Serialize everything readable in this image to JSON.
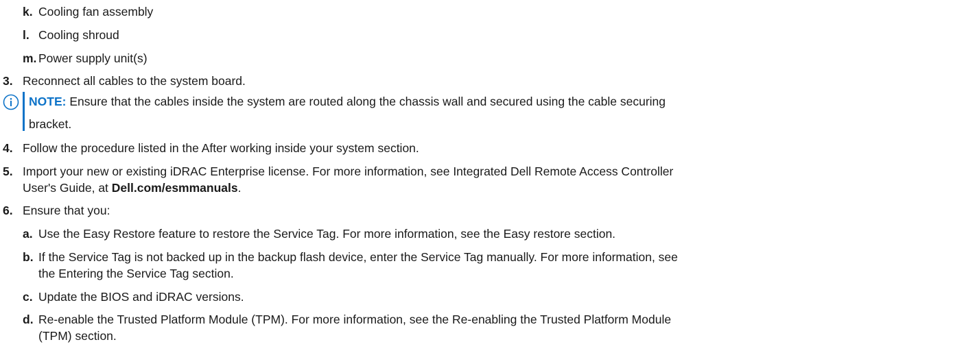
{
  "steps": {
    "k": {
      "marker": "k.",
      "text": "Cooling fan assembly"
    },
    "l": {
      "marker": "l.",
      "text": "Cooling shroud"
    },
    "m": {
      "marker": "m.",
      "text": "Power supply unit(s)"
    },
    "s3": {
      "marker": "3.",
      "text": "Reconnect all cables to the system board."
    },
    "note": {
      "label": "NOTE:",
      "text1": " Ensure that the cables inside the system are routed along the chassis wall and secured using the cable securing",
      "text2": "bracket."
    },
    "s4": {
      "marker": "4.",
      "text": "Follow the procedure listed in the After working inside your system section."
    },
    "s5": {
      "marker": "5.",
      "text1": "Import your new or existing iDRAC Enterprise license. For more information, see Integrated Dell Remote Access Controller",
      "text2a": "User's Guide, at ",
      "link": "Dell.com/esmmanuals",
      "text2b": "."
    },
    "s6": {
      "marker": "6.",
      "text": "Ensure that you:"
    },
    "a": {
      "marker": "a.",
      "text": "Use the Easy Restore feature to restore the Service Tag. For more information, see the Easy restore section."
    },
    "b": {
      "marker": "b.",
      "text1": "If the Service Tag is not backed up in the backup flash device, enter the Service Tag manually. For more information, see",
      "text2": "the Entering the Service Tag section."
    },
    "c": {
      "marker": "c.",
      "text": "Update the BIOS and iDRAC versions."
    },
    "d": {
      "marker": "d.",
      "text1": "Re-enable the Trusted Platform Module (TPM). For more information, see the Re-enabling the Trusted Platform Module",
      "text2": "(TPM) section."
    }
  },
  "colors": {
    "accent": "#0d73c8",
    "text": "#1a1a1a"
  },
  "icons": {
    "note": "info-circle-icon"
  }
}
